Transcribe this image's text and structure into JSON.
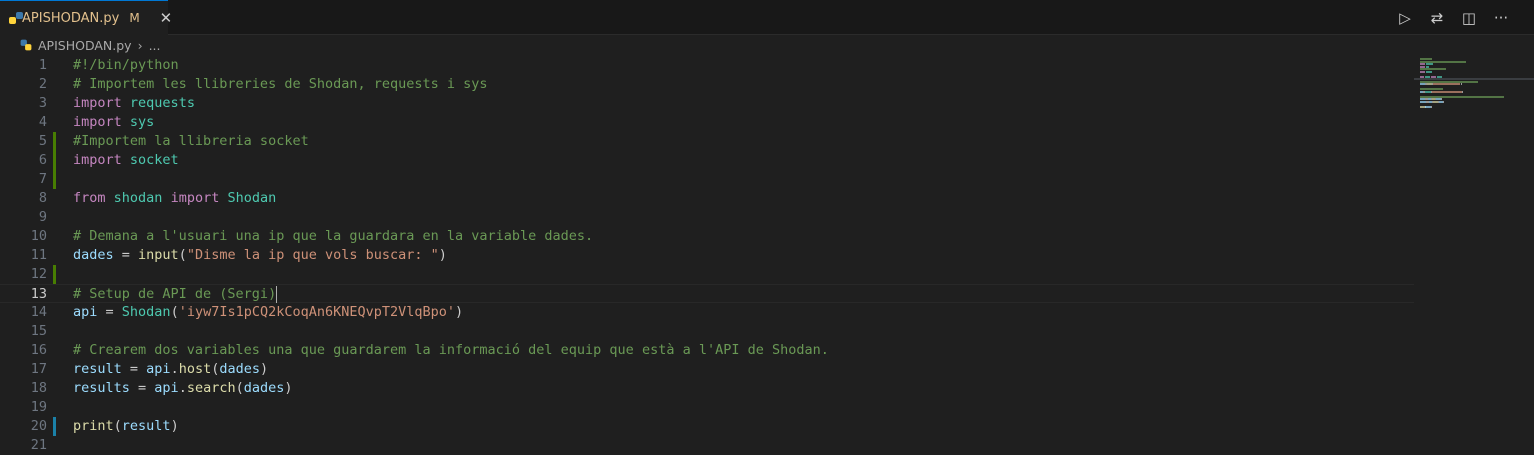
{
  "tab": {
    "filename": "APISHODAN.py",
    "status": "M",
    "close_glyph": "✕"
  },
  "actions": {
    "run_glyph": "▷",
    "compare_glyph": "⇄",
    "split_glyph": "◫",
    "more_glyph": "···"
  },
  "breadcrumb": {
    "file": "APISHODAN.py",
    "separator": "›",
    "rest": "..."
  },
  "editor": {
    "current_line": 13,
    "lines": [
      {
        "n": "1",
        "tokens": [
          {
            "t": "#!/bin/python",
            "c": "comment"
          }
        ]
      },
      {
        "n": "2",
        "tokens": [
          {
            "t": "# Importem les llibreries de Shodan, requests i sys",
            "c": "comment"
          }
        ]
      },
      {
        "n": "3",
        "tokens": [
          {
            "t": "import",
            "c": "keyword"
          },
          {
            "t": " ",
            "c": "punct"
          },
          {
            "t": "requests",
            "c": "module"
          }
        ]
      },
      {
        "n": "4",
        "tokens": [
          {
            "t": "import",
            "c": "keyword"
          },
          {
            "t": " ",
            "c": "punct"
          },
          {
            "t": "sys",
            "c": "module"
          }
        ]
      },
      {
        "n": "5",
        "gutter": "added",
        "tokens": [
          {
            "t": "#Importem la llibreria socket",
            "c": "comment"
          }
        ]
      },
      {
        "n": "6",
        "gutter": "added",
        "tokens": [
          {
            "t": "import",
            "c": "keyword"
          },
          {
            "t": " ",
            "c": "punct"
          },
          {
            "t": "socket",
            "c": "module"
          }
        ]
      },
      {
        "n": "7",
        "gutter": "added",
        "tokens": []
      },
      {
        "n": "8",
        "tokens": [
          {
            "t": "from",
            "c": "keyword"
          },
          {
            "t": " ",
            "c": "punct"
          },
          {
            "t": "shodan",
            "c": "module"
          },
          {
            "t": " ",
            "c": "punct"
          },
          {
            "t": "import",
            "c": "keyword"
          },
          {
            "t": " ",
            "c": "punct"
          },
          {
            "t": "Shodan",
            "c": "class"
          }
        ]
      },
      {
        "n": "9",
        "tokens": []
      },
      {
        "n": "10",
        "tokens": [
          {
            "t": "# Demana a l'usuari una ip que la guardara en la variable dades.",
            "c": "comment"
          }
        ]
      },
      {
        "n": "11",
        "tokens": [
          {
            "t": "dades",
            "c": "var"
          },
          {
            "t": " = ",
            "c": "punct"
          },
          {
            "t": "input",
            "c": "func"
          },
          {
            "t": "(",
            "c": "punct"
          },
          {
            "t": "\"Disme la ip que vols buscar: \"",
            "c": "string"
          },
          {
            "t": ")",
            "c": "punct"
          }
        ]
      },
      {
        "n": "12",
        "gutter": "added",
        "tokens": []
      },
      {
        "n": "13",
        "tokens": [
          {
            "t": "# Setup de API de (Sergi)",
            "c": "comment"
          }
        ],
        "caret": true
      },
      {
        "n": "14",
        "tokens": [
          {
            "t": "api",
            "c": "var"
          },
          {
            "t": " = ",
            "c": "punct"
          },
          {
            "t": "Shodan",
            "c": "class"
          },
          {
            "t": "(",
            "c": "punct"
          },
          {
            "t": "'iyw7Is1pCQ2kCoqAn6KNEQvpT2VlqBpo'",
            "c": "string"
          },
          {
            "t": ")",
            "c": "punct"
          }
        ]
      },
      {
        "n": "15",
        "tokens": []
      },
      {
        "n": "16",
        "tokens": [
          {
            "t": "# Crearem dos variables una que guardarem la informació del equip que està a l'API de Shodan.",
            "c": "comment"
          }
        ]
      },
      {
        "n": "17",
        "tokens": [
          {
            "t": "result",
            "c": "var"
          },
          {
            "t": " = ",
            "c": "punct"
          },
          {
            "t": "api",
            "c": "var"
          },
          {
            "t": ".",
            "c": "punct"
          },
          {
            "t": "host",
            "c": "func"
          },
          {
            "t": "(",
            "c": "punct"
          },
          {
            "t": "dades",
            "c": "var"
          },
          {
            "t": ")",
            "c": "punct"
          }
        ]
      },
      {
        "n": "18",
        "tokens": [
          {
            "t": "results",
            "c": "var"
          },
          {
            "t": " = ",
            "c": "punct"
          },
          {
            "t": "api",
            "c": "var"
          },
          {
            "t": ".",
            "c": "punct"
          },
          {
            "t": "search",
            "c": "func"
          },
          {
            "t": "(",
            "c": "punct"
          },
          {
            "t": "dades",
            "c": "var"
          },
          {
            "t": ")",
            "c": "punct"
          }
        ]
      },
      {
        "n": "19",
        "tokens": []
      },
      {
        "n": "20",
        "gutter": "modified",
        "tokens": [
          {
            "t": "print",
            "c": "func"
          },
          {
            "t": "(",
            "c": "punct"
          },
          {
            "t": "result",
            "c": "var"
          },
          {
            "t": ")",
            "c": "punct"
          }
        ]
      },
      {
        "n": "21",
        "tokens": []
      }
    ]
  }
}
